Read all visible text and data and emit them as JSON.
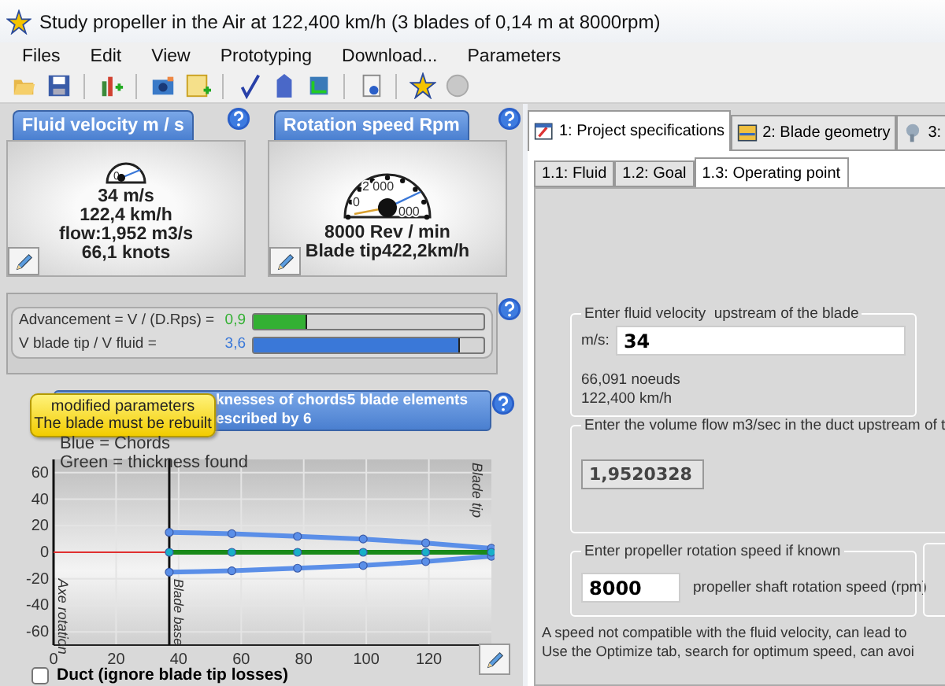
{
  "window": {
    "title": "Study propeller in the Air at 122,400 km/h (3 blades of 0,14 m at 8000rpm)"
  },
  "menu": [
    "Files",
    "Edit",
    "View",
    "Prototyping",
    "Download...",
    "Parameters"
  ],
  "gauges": [
    {
      "kind": "small",
      "label": "Fluid velocity m / s",
      "dial_labels": [
        "0"
      ],
      "lines": [
        "34 m/s",
        "122,4 km/h",
        "flow:1,952 m3/s",
        "66,1 knots"
      ]
    },
    {
      "kind": "large",
      "label": "Rotation speed Rpm",
      "dial_labels": [
        "2 000",
        "0",
        "000"
      ],
      "lines": [
        "8000 Rev / min",
        "Blade tip422,2km/h"
      ]
    }
  ],
  "ratios": [
    {
      "label": "Advancement = V / (D.Rps) =",
      "reading": "0,9",
      "level": 0.23,
      "color": "#33b033"
    },
    {
      "label": "V blade tip / V fluid =",
      "reading": "3,6",
      "level": 0.9,
      "color": "#3a78d8"
    }
  ],
  "chart_section": {
    "title_lines": [
      "knesses of chords5 blade elements",
      "escribed by 6"
    ],
    "notice": [
      "modified parameters",
      "The blade must be rebuilt"
    ],
    "legend": [
      "Blue = Chords",
      "Green = thickness found"
    ],
    "chart_data": {
      "type": "line",
      "x": [
        37,
        57,
        78,
        99,
        119,
        140
      ],
      "grid": true,
      "series": [
        {
          "color": "#5b8fe8",
          "marker": "o",
          "values": [
            15,
            14,
            12,
            10,
            7,
            3
          ]
        },
        {
          "color": "#5b8fe8",
          "marker": "o",
          "values": [
            -15,
            -14,
            -12,
            -10,
            -7,
            -3
          ]
        },
        {
          "color": "#1a8a1a",
          "marker": "o",
          "values": [
            0,
            0,
            0,
            0,
            0,
            0
          ]
        }
      ],
      "xlim": [
        0,
        140
      ],
      "ylim": [
        -70,
        70
      ],
      "xticks": [
        0,
        20,
        40,
        60,
        80,
        100,
        120
      ],
      "yticks": [
        -60,
        -40,
        -20,
        0,
        20,
        40,
        60
      ],
      "ref_lines": [
        {
          "axis": "x",
          "value": 37,
          "label": "Blade base",
          "color": "#111111"
        },
        {
          "axis": "y",
          "value": 0,
          "color": "#e03030"
        }
      ],
      "annotations": [
        "Axe rotation",
        "Blade tip"
      ]
    },
    "duct": {
      "label": "Duct (ignore blade tip losses)",
      "checked": false
    }
  },
  "tabs": [
    {
      "label": "1: Project specifications",
      "selected": true
    },
    {
      "label": "2: Blade geometry",
      "selected": false
    },
    {
      "label": "3:",
      "selected": false
    }
  ],
  "subtabs": [
    {
      "label": "1.1: Fluid",
      "selected": false
    },
    {
      "label": "1.2: Goal",
      "selected": false
    },
    {
      "label": "1.3: Operating point",
      "selected": true
    }
  ],
  "velocity_group": {
    "legend": "Enter fluid velocity  upstream of the blade",
    "unit": "m/s:",
    "value": "34",
    "lines": [
      "66,091 noeuds",
      "122,400 km/h"
    ]
  },
  "flow_group": {
    "legend": "Enter the volume flow m3/sec in the duct upstream of t",
    "value": "1,9520328",
    "disabled": true
  },
  "speed_group": {
    "legend": "Enter propeller rotation speed if known",
    "value": "8000",
    "caption": "propeller shaft rotation speed (rpm)"
  },
  "notes": [
    "A speed not compatible with the fluid velocity, can lead to",
    "Use the Optimize tab, search for optimum speed, can avoi"
  ]
}
